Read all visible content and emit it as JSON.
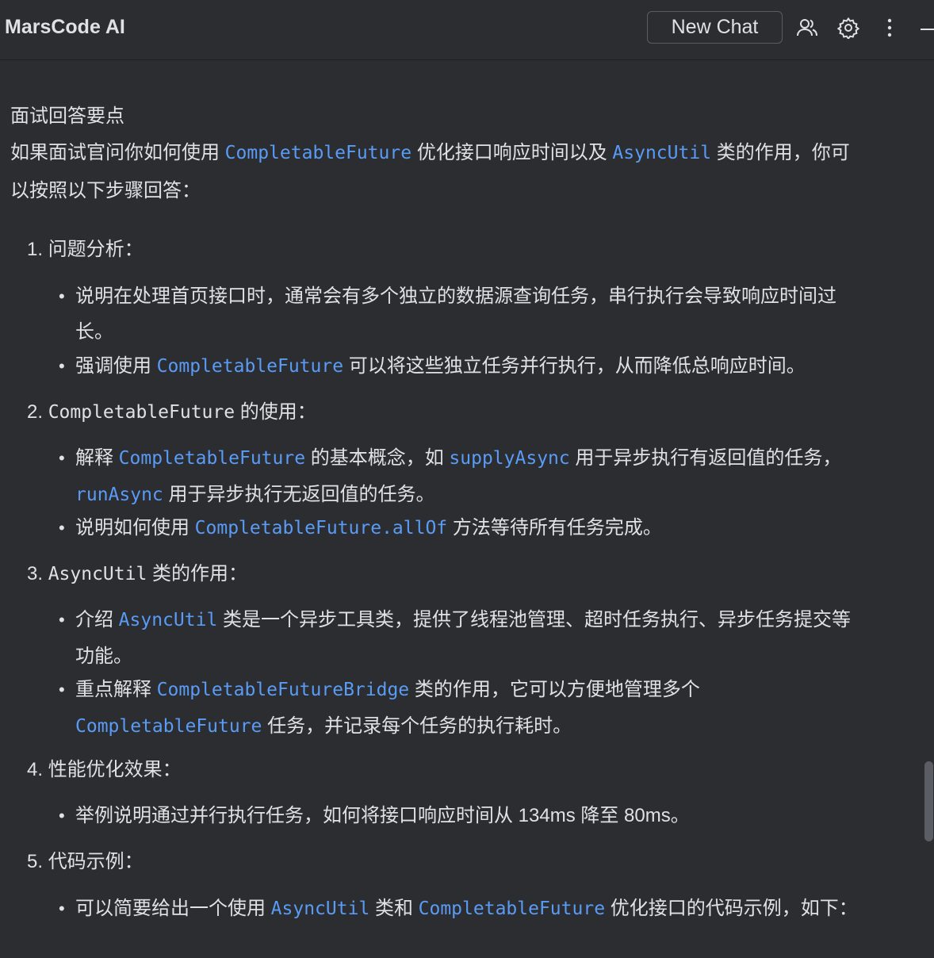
{
  "header": {
    "title": "MarsCode AI",
    "new_chat_label": "New Chat",
    "icons": [
      "users-icon",
      "gear-icon",
      "more-vertical-icon",
      "minimize-icon"
    ]
  },
  "intro": {
    "heading": "面试回答要点",
    "line1_a": "如果面试官问你如何使用 ",
    "line1_code1": "CompletableFuture",
    "line1_b": " 优化接口响应时间以及 ",
    "line1_code2": "AsyncUtil",
    "line1_c": " 类的作用，你可",
    "line2": "以按照以下步骤回答："
  },
  "sections": [
    {
      "number": "1.",
      "title": "问题分析：",
      "bullets": [
        {
          "line1": "说明在处理首页接口时，通常会有多个独立的数据源查询任务，串行执行会导致响应时间过",
          "line2": "长。"
        },
        {
          "pre": "强调使用 ",
          "code": "CompletableFuture",
          "post": " 可以将这些独立任务并行执行，从而降低总响应时间。"
        }
      ]
    },
    {
      "number": "2.",
      "title_code": "CompletableFuture",
      "title_post": " 的使用：",
      "bullets": [
        {
          "pre": "解释 ",
          "code1": "CompletableFuture",
          "mid": " 的基本概念，如 ",
          "code2": "supplyAsync",
          "post": " 用于异步执行有返回值的任务，",
          "line2_code": "runAsync",
          "line2_post": " 用于异步执行无返回值的任务。"
        },
        {
          "pre": "说明如何使用 ",
          "code": "CompletableFuture.allOf",
          "post": " 方法等待所有任务完成。"
        }
      ]
    },
    {
      "number": "3.",
      "title_code": "AsyncUtil",
      "title_post": " 类的作用：",
      "bullets": [
        {
          "pre": "介绍 ",
          "code": "AsyncUtil",
          "post": " 类是一个异步工具类，提供了线程池管理、超时任务执行、异步任务提交等",
          "line2": "功能。"
        },
        {
          "pre": "重点解释 ",
          "code": "CompletableFutureBridge",
          "post": " 类的作用，它可以方便地管理多个",
          "line2_code": "CompletableFuture",
          "line2_post": " 任务，并记录每个任务的执行耗时。"
        }
      ]
    },
    {
      "number": "4.",
      "title": "性能优化效果：",
      "bullets": [
        {
          "text": "举例说明通过并行执行任务，如何将接口响应时间从 134ms 降至 80ms。"
        }
      ]
    },
    {
      "number": "5.",
      "title": "代码示例：",
      "bullets": [
        {
          "pre": "可以简要给出一个使用 ",
          "code1": "AsyncUtil",
          "mid": " 类和 ",
          "code2": "CompletableFuture",
          "post": " 优化接口的代码示例，如下："
        }
      ]
    }
  ],
  "bullet_char": "•",
  "colors": {
    "background": "#2b2d30",
    "text": "#dfe1e5",
    "code": "#5a9bf6"
  }
}
